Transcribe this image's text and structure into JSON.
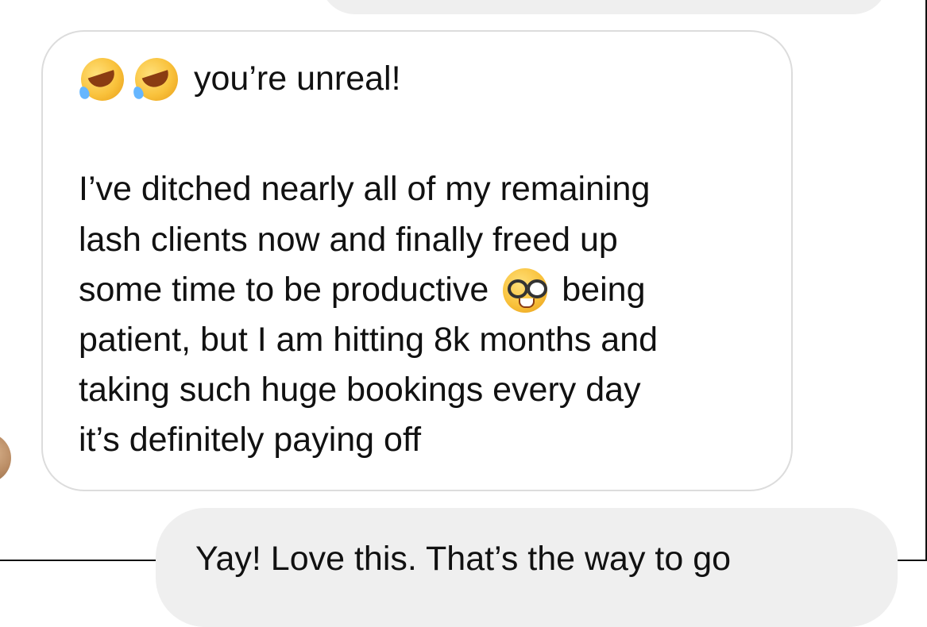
{
  "conversation": {
    "received_message": {
      "emojis_line_1": [
        "rolling-on-floor-laughing-emoji",
        "rolling-on-floor-laughing-emoji"
      ],
      "line_1_text": "you’re unreal!",
      "line_2": "I’ve ditched nearly all of my remaining",
      "line_3": "lash clients now and finally freed up",
      "line_4_part_1": "some time to be productive",
      "line_4_emoji": "nerd-face-emoji",
      "line_4_part_2": "being",
      "line_5": "patient, but I am hitting 8k months and",
      "line_6": "taking such huge bookings every day",
      "line_7": "it’s definitely paying off"
    },
    "sent_message_bottom": {
      "text": "Yay! Love this. That’s the way to go"
    }
  },
  "colors": {
    "sent_bubble_bg": "#efefef",
    "received_bubble_border": "#dcdcdc",
    "text": "#111111"
  }
}
